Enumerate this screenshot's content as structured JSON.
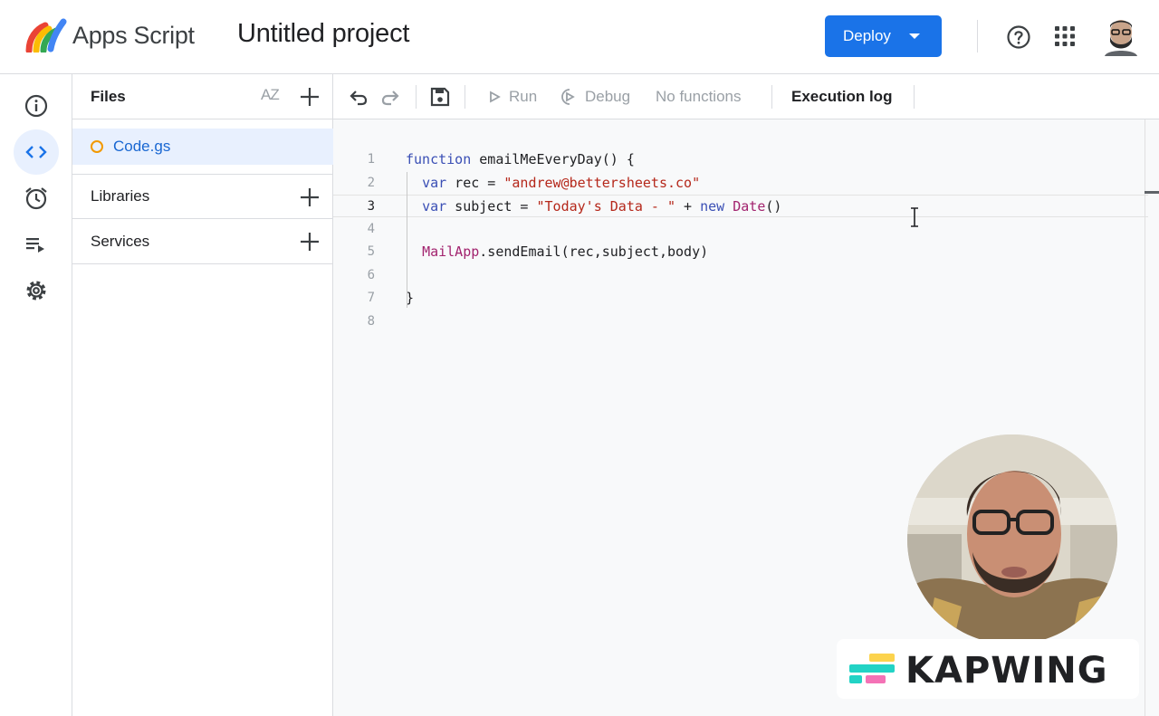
{
  "header": {
    "app_name": "Apps Script",
    "project_title": "Untitled project",
    "deploy_label": "Deploy"
  },
  "rail": {
    "items": [
      "info-icon",
      "code-icon",
      "clock-icon",
      "executions-icon",
      "settings-icon"
    ],
    "active": "code-icon"
  },
  "files_panel": {
    "files_title": "Files",
    "sort_label": "AZ",
    "files": [
      {
        "name": "Code.gs",
        "selected": true
      }
    ],
    "libraries_title": "Libraries",
    "services_title": "Services"
  },
  "toolbar": {
    "run_label": "Run",
    "debug_label": "Debug",
    "functions_label": "No functions",
    "execution_log_label": "Execution log"
  },
  "editor": {
    "current_line": 3,
    "lines": [
      {
        "n": "1",
        "text": "function emailMeEveryDay() {"
      },
      {
        "n": "2",
        "text": "  var rec = \"andrew@bettersheets.co\""
      },
      {
        "n": "3",
        "text": "  var subject = \"Today's Data - \" + new Date()"
      },
      {
        "n": "4",
        "text": ""
      },
      {
        "n": "5",
        "text": "  MailApp.sendEmail(rec,subject,body)"
      },
      {
        "n": "6",
        "text": ""
      },
      {
        "n": "7",
        "text": "}"
      },
      {
        "n": "8",
        "text": ""
      }
    ]
  },
  "watermark": {
    "text": "KAPWING"
  },
  "colors": {
    "accent": "#1a73e8",
    "selected_bg": "#e8f0fe",
    "file_dot": "#f29900",
    "keyword": "#3a4fb5",
    "string": "#b5281b"
  }
}
